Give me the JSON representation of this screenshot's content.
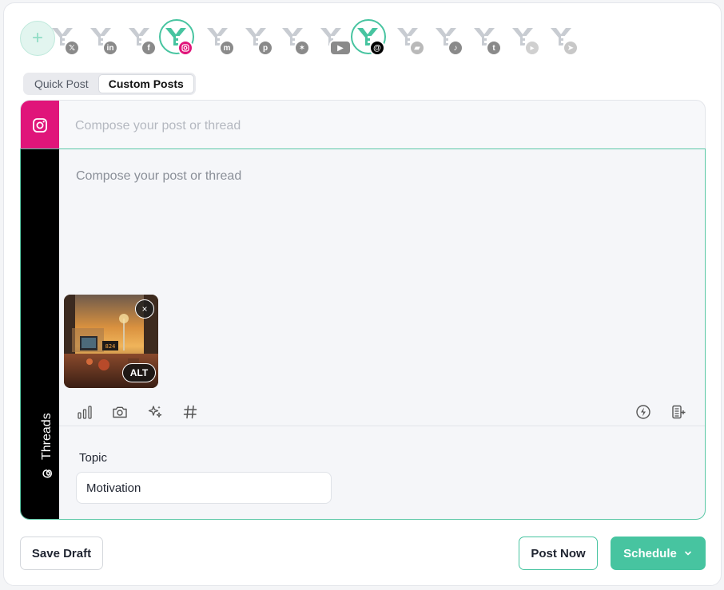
{
  "accounts": {
    "add_symbol": "+",
    "items": [
      {
        "network": "x",
        "icon": "x-icon",
        "color": "#8a8a8a",
        "selected": false
      },
      {
        "network": "linkedin",
        "icon": "linkedin-icon",
        "color": "#8a8a8a",
        "selected": false
      },
      {
        "network": "facebook",
        "icon": "facebook-icon",
        "color": "#8a8a8a",
        "selected": false
      },
      {
        "network": "instagram",
        "icon": "instagram-icon",
        "color": "#e0157a",
        "selected": true
      },
      {
        "network": "mastodon",
        "icon": "mastodon-icon",
        "color": "#8a8a8a",
        "selected": false
      },
      {
        "network": "pinterest",
        "icon": "pinterest-icon",
        "color": "#8a8a8a",
        "selected": false
      },
      {
        "network": "bluesky",
        "icon": "bluesky-icon",
        "color": "#8a8a8a",
        "selected": false
      },
      {
        "network": "youtube",
        "icon": "youtube-icon",
        "color": "#8a8a8a",
        "selected": false
      },
      {
        "network": "threads",
        "icon": "threads-icon",
        "color": "#000000",
        "selected": true
      },
      {
        "network": "google-business",
        "icon": "google-business-icon",
        "color": "#b9b9b9",
        "selected": false
      },
      {
        "network": "tiktok",
        "icon": "tiktok-icon",
        "color": "#8a8a8a",
        "selected": false
      },
      {
        "network": "tumblr",
        "icon": "tumblr-icon",
        "color": "#8a8a8a",
        "selected": false
      },
      {
        "network": "google-play",
        "icon": "play-icon",
        "color": "#d0d0d0",
        "selected": false
      },
      {
        "network": "telegram",
        "icon": "telegram-icon",
        "color": "#c8c8c8",
        "selected": false
      }
    ]
  },
  "tabs": [
    {
      "label": "Quick Post",
      "active": false
    },
    {
      "label": "Custom Posts",
      "active": true
    }
  ],
  "instagram": {
    "placeholder": "Compose your post or thread",
    "color": "#e0157a"
  },
  "threads": {
    "label": "Threads",
    "placeholder": "Compose your post or thread",
    "media": {
      "alt_label": "ALT",
      "remove_symbol": "×"
    },
    "topic": {
      "label": "Topic",
      "value": "Motivation"
    }
  },
  "footer": {
    "save_draft": "Save Draft",
    "post_now": "Post Now",
    "schedule": "Schedule"
  },
  "colors": {
    "accent": "#47c4a0",
    "instagram": "#e0157a",
    "threads": "#000000"
  }
}
